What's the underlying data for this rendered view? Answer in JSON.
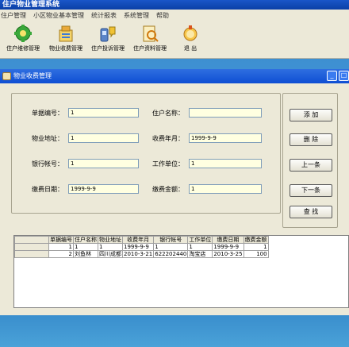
{
  "app": {
    "title": "住户物业管理系统"
  },
  "menu": [
    "住户管理",
    "小区物业基本管理",
    "统计报表",
    "系统管理",
    "帮助"
  ],
  "toolbar": [
    {
      "label": "住户维修管理",
      "icon": "gear-icon"
    },
    {
      "label": "物业收费管理",
      "icon": "billing-icon"
    },
    {
      "label": "住户投诉管理",
      "icon": "complaint-icon"
    },
    {
      "label": "住户资料管理",
      "icon": "records-icon"
    },
    {
      "label": "退 出",
      "icon": "exit-icon"
    }
  ],
  "window": {
    "title": "物业收费管理"
  },
  "form": {
    "receipt_no": {
      "label": "单据编号：",
      "value": "1"
    },
    "owner_name": {
      "label": "住户名称：",
      "value": ""
    },
    "address": {
      "label": "物业地址：",
      "value": "1"
    },
    "fee_month": {
      "label": "收费年月：",
      "value": "1999-9-9"
    },
    "bank_account": {
      "label": "银行帐号：",
      "value": "1"
    },
    "work_unit": {
      "label": "工作单位：",
      "value": "1"
    },
    "pay_date": {
      "label": "缴费日期：",
      "value": "1999-9-9"
    },
    "amount": {
      "label": "缴费金额：",
      "value": "1"
    }
  },
  "buttons": {
    "add": "添 加",
    "delete": "删 除",
    "prev": "上一条",
    "next": "下一条",
    "search": "查 找"
  },
  "table": {
    "columns": [
      "单据编号",
      "住户名称",
      "物业地址",
      "收费年月",
      "银行帐号",
      "工作单位",
      "缴费日期",
      "缴费金额"
    ],
    "rows": [
      [
        "1",
        "1",
        "1",
        "1999-9-9",
        "1",
        "1",
        "1999-9-9",
        "1"
      ],
      [
        "2",
        "刘鱼林",
        "四川成都",
        "2010-3-21",
        "622202440",
        "淘宝店",
        "2010-3-25",
        "100"
      ]
    ]
  }
}
